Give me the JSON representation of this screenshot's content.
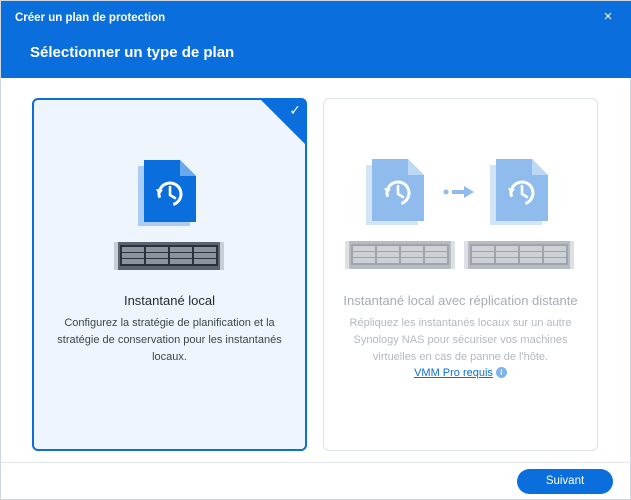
{
  "dialog": {
    "window_title": "Créer un plan de protection",
    "step_title": "Sélectionner un type de plan",
    "close_icon": "×"
  },
  "cards": {
    "local": {
      "title": "Instantané local",
      "description": "Configurez la stratégie de planification et la stratégie de conservation pour les instantanés locaux.",
      "selected": true,
      "check_icon": "✓"
    },
    "remote": {
      "title": "Instantané local avec réplication distante",
      "description": "Répliquez les instantanés locaux sur un autre Synology NAS pour sécuriser vos machines virtuelles en cas de panne de l'hôte.",
      "requirement_link": "VMM Pro requis",
      "info_icon": "i",
      "disabled": true
    }
  },
  "footer": {
    "next_label": "Suivant"
  },
  "colors": {
    "accent": "#0a6fdc",
    "selected_bg": "#eef5fc",
    "disabled_icon": "#8fbcec"
  }
}
